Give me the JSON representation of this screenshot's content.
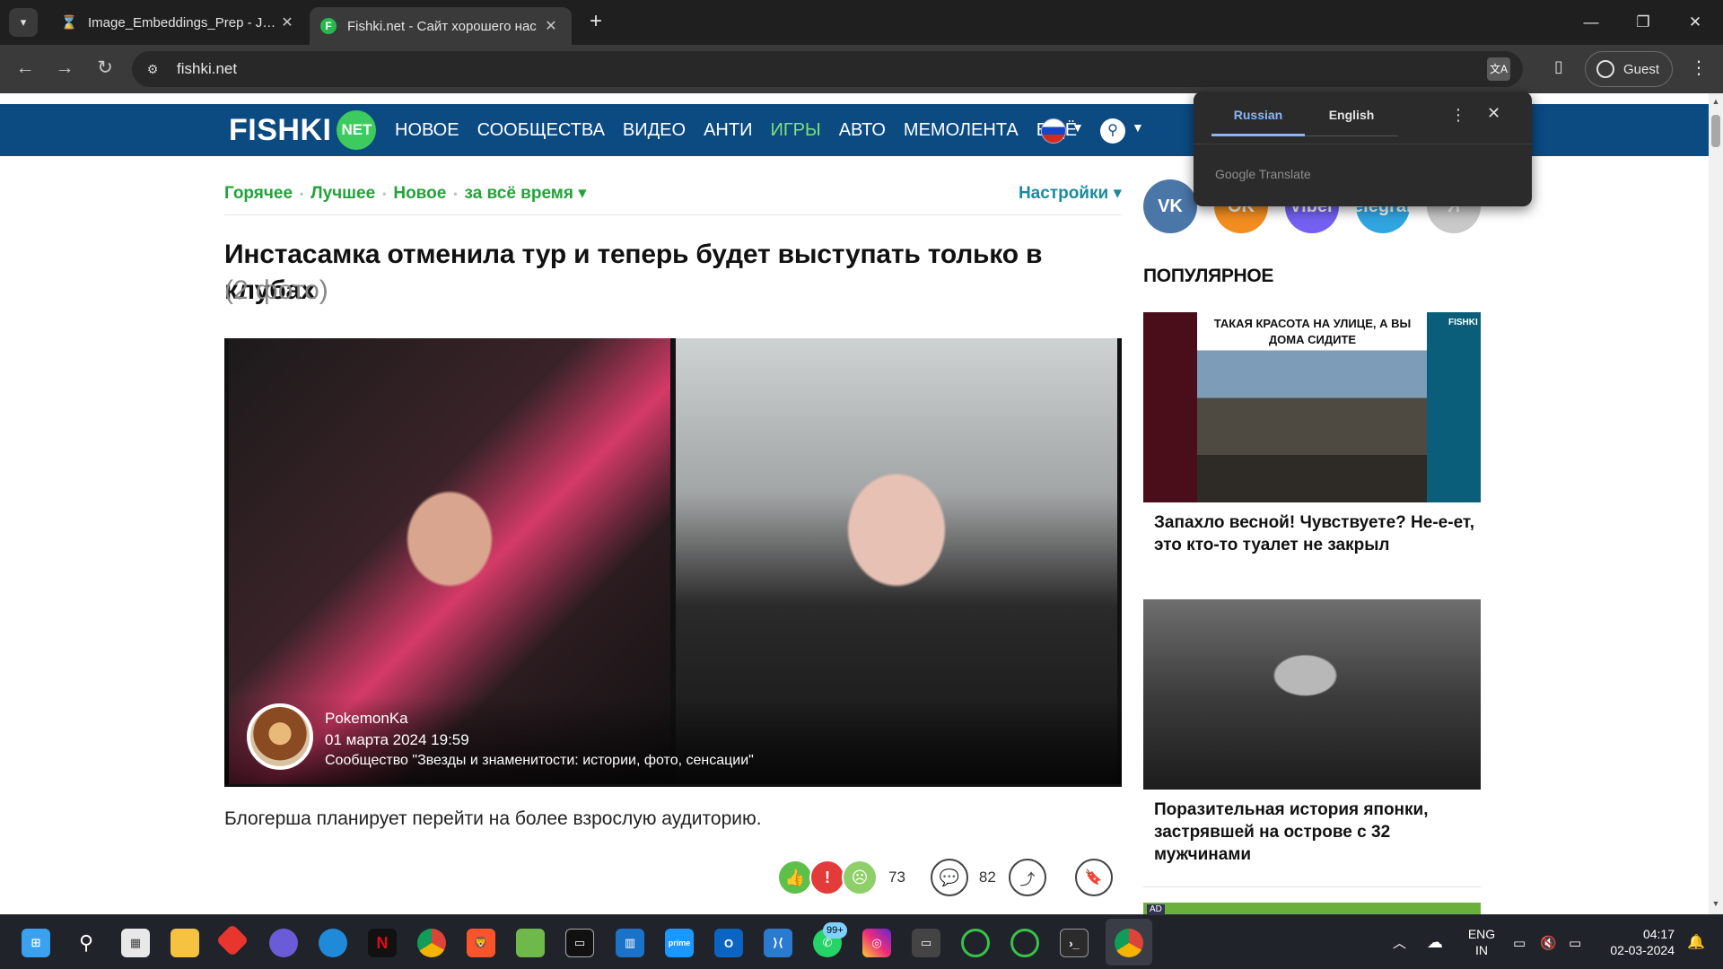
{
  "browser": {
    "tabs": [
      {
        "title": "Image_Embeddings_Prep - Jupy",
        "favicon_icon": "hourglass-icon",
        "close": "✕"
      },
      {
        "title": "Fishki.net - Сайт хорошего нас",
        "favicon_letter": "F",
        "close": "✕"
      }
    ],
    "new_tab": "+",
    "url": "fishki.net",
    "profile_label": "Guest"
  },
  "site": {
    "logo_text": "FISHKI",
    "logo_badge": "NET",
    "menu": [
      {
        "label": "НОВОЕ"
      },
      {
        "label": "СООБЩЕСТВА"
      },
      {
        "label": "ВИДЕО"
      },
      {
        "label": "АНТИ"
      },
      {
        "label": "ИГРЫ"
      },
      {
        "label": "АВТО"
      },
      {
        "label": "МЕМОЛЕНТА"
      },
      {
        "label": "ЕЩЁ"
      }
    ],
    "accent_green": "#22a339",
    "nav_bg": "#0c4a82"
  },
  "filters": {
    "items": [
      "Горячее",
      "Лучшее",
      "Новое",
      "за всё время ▾"
    ],
    "separator": "•",
    "settings_label": "Настройки ▾"
  },
  "article": {
    "title": "Инстасамка отменила тур и теперь будет выступать только в клубах",
    "photo_count": "(2 фото)",
    "author": "PokemonKa",
    "date": "01 марта 2024 19:59",
    "community": "Сообщество \"Звезды и знаменитости: истории, фото, сенсации\"",
    "lead": "Блогерша планирует перейти на более взрослую аудиторию.",
    "reactions_count": "73",
    "comments_count": "82"
  },
  "sidebar": {
    "socials": [
      "VK",
      "OK",
      "Viber",
      "Telegram",
      "Я"
    ],
    "popular_title": "ПОПУЛЯРНОЕ",
    "cards": [
      {
        "image_caption": "ТАКАЯ КРАСОТА НА УЛИЦЕ, А ВЫ ДОМА СИДИТЕ",
        "image_brand": "FISHKI",
        "title": "Запахло весной! Чувствуете? Не-е-ет, это кто-то туалет не закрыл"
      },
      {
        "title": "Поразительная история японки, застрявшей на острове с 32 мужчинами"
      }
    ],
    "ad_label": "AD"
  },
  "translate_popup": {
    "tab_source": "Russian",
    "tab_target": "English",
    "brand": "Google Translate"
  },
  "taskbar": {
    "whatsapp_badge": "99+",
    "lang_line1": "ENG",
    "lang_line2": "IN",
    "time": "04:17",
    "date": "02-03-2024"
  }
}
